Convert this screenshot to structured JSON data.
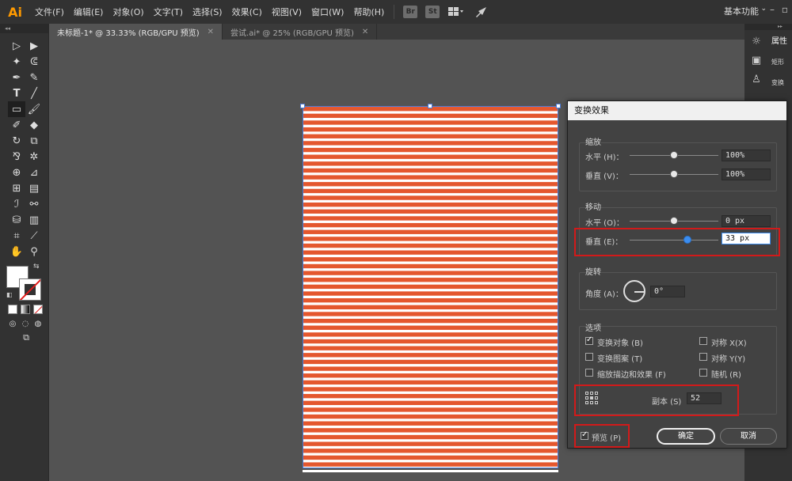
{
  "app": {
    "logo": "Ai",
    "menu": [
      "文件(F)",
      "编辑(E)",
      "对象(O)",
      "文字(T)",
      "选择(S)",
      "效果(C)",
      "视图(V)",
      "窗口(W)",
      "帮助(H)"
    ],
    "bridge_labels": [
      "Br",
      "St"
    ],
    "workspace": "基本功能"
  },
  "tabs": [
    {
      "label": "未标题-1* @ 33.33% (RGB/GPU 预览)",
      "active": true
    },
    {
      "label": "尝试.ai* @ 25% (RGB/GPU 预览)",
      "active": false
    }
  ],
  "colors": {
    "stripe": "#e4572e",
    "stripe_gap": "#ffffff",
    "selection": "#4a7bd8",
    "annotation": "#d21a1a",
    "slider_active": "#3b8df0"
  },
  "artwork": {
    "stripe_count": 53
  },
  "right_panel": {
    "title": "属性",
    "labels": [
      "矩形",
      "变换"
    ]
  },
  "dialog": {
    "title": "变换效果",
    "scale": {
      "title": "缩放",
      "horizontal_label": "水平 (H)：",
      "horizontal_value": "100%",
      "horizontal_level": 0.5,
      "vertical_label": "垂直 (V)：",
      "vertical_value": "100%",
      "vertical_level": 0.5
    },
    "move": {
      "title": "移动",
      "horizontal_label": "水平 (O)：",
      "horizontal_value": "0 px",
      "horizontal_level": 0.5,
      "vertical_label": "垂直 (E)：",
      "vertical_value": "33 px",
      "vertical_level": 0.65
    },
    "rotate": {
      "title": "旋转",
      "angle_label": "角度 (A)：",
      "angle_value": "0°"
    },
    "options": {
      "title": "选项",
      "transform_objects": "变换对象 (B)",
      "transform_patterns": "变换图案 (T)",
      "scale_strokes": "缩放描边和效果 (F)",
      "reflect_x": "对称 X(X)",
      "reflect_y": "对称 Y(Y)",
      "random": "随机 (R)"
    },
    "copies_label": "副本 (S)",
    "copies_value": "52",
    "preview_label": "预览 (P)",
    "ok_label": "确定",
    "cancel_label": "取消"
  }
}
